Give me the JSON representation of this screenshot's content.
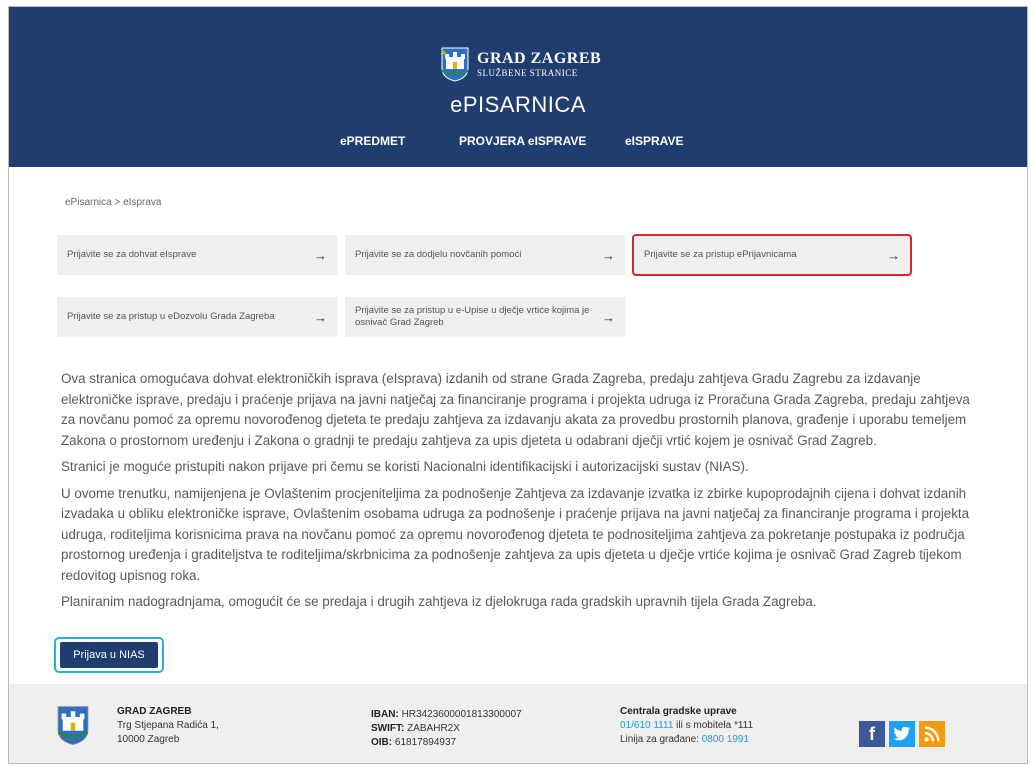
{
  "header": {
    "logo_title": "GRAD ZAGREB",
    "logo_subtitle": "SLUŽBENE STRANICE",
    "site_title": "ePISARNICA",
    "nav": [
      {
        "label": "ePREDMET"
      },
      {
        "label": "PROVJERA eISPRAVE"
      },
      {
        "label": "eISPRAVE"
      }
    ]
  },
  "breadcrumb": "ePisarnica > eIsprava",
  "tiles": [
    {
      "label": "Prijavite se za dohvat eIsprave",
      "arrow": "→"
    },
    {
      "label": "Prijavite se za dodjelu novčanih pomoći",
      "arrow": "→"
    },
    {
      "label": "Prijavite se za pristup ePrijavnicama",
      "arrow": "→"
    },
    {
      "label": "Prijavite se za pristup u eDozvolu Grada Zagreba",
      "arrow": "→"
    },
    {
      "label": "Prijavite se za pristup u e-Upise u dječje vrtiće kojima je osnivač Grad Zagreb",
      "arrow": "→"
    }
  ],
  "description": [
    "Ova stranica omogućava dohvat elektroničkih isprava (eIsprava) izdanih od strane Grada Zagreba, predaju zahtjeva Gradu Zagrebu za izdavanje elektroničke isprave, predaju i praćenje prijava na javni natječaj za financiranje programa i projekta udruga iz Proračuna Grada Zagreba, predaju zahtjeva za novčanu pomoć za opremu novorođenog djeteta te predaju zahtjeva za izdavanju akata za provedbu prostornih planova, građenje i uporabu temeljem Zakona o prostornom uređenju i Zakona o gradnji te predaju zahtjeva za upis djeteta u odabrani dječji vrtić kojem je osnivač Grad Zagreb.",
    "Stranici je moguće pristupiti nakon prijave pri čemu se koristi Nacionalni identifikacijski i autorizacijski sustav (NIAS).",
    "U ovome trenutku, namijenjena je Ovlaštenim procjeniteljima za podnošenje Zahtjeva za izdavanje izvatka iz zbirke kupoprodajnih cijena i dohvat izdanih izvadaka u obliku elektroničke isprave, Ovlaštenim osobama udruga za podnošenje i praćenje prijava na javni natječaj za financiranje programa i projekta udruga, roditeljima korisnicima prava na novčanu pomoć za opremu novorođenog djeteta te podnositeljima zahtjeva za pokretanje postupaka iz područja prostornog uređenja i graditeljstva te roditeljima/skrbnicima za podnošenje zahtjeva za upis djeteta u dječje vrtiće kojima je osnivač Grad Zagreb tijekom redovitog upisnog roka.",
    "Planiranim nadogradnjama, omogućit će se predaja i drugih zahtjeva iz djelokruga rada gradskih upravnih tijela Grada Zagreba."
  ],
  "nias_button": "Prijava u NIAS",
  "footer": {
    "org_name": "GRAD ZAGREB",
    "address_1": "Trg Stjepana Radića 1,",
    "address_2": "10000 Zagreb",
    "iban_label": "IBAN:",
    "iban": "HR3423600001813300007",
    "swift_label": "SWIFT:",
    "swift": "ZABAHR2X",
    "oib_label": "OIB:",
    "oib": "61817894937",
    "central_title": "Centrala gradske uprave",
    "phone": "01/610 1111",
    "phone_suffix": "ili s mobitela *111",
    "citizens_label": "Linija za građane:",
    "citizens_phone": "0800 1991",
    "social": [
      {
        "icon": "facebook-icon",
        "glyph": "f",
        "color": "#3b5998"
      },
      {
        "icon": "twitter-icon",
        "glyph": "t",
        "color": "#1da1f2"
      },
      {
        "icon": "rss-icon",
        "glyph": "rss",
        "color": "#f39c12"
      }
    ]
  }
}
